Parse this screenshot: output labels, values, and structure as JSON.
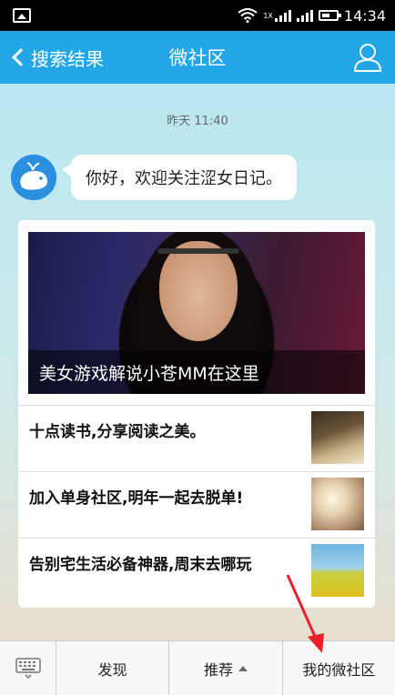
{
  "status_bar": {
    "network_label": "1X",
    "time": "14:34"
  },
  "header": {
    "back_label": "搜索结果",
    "title": "微社区"
  },
  "chat": {
    "timestamp": "昨天 11:40",
    "greeting": "你好，欢迎关注涩女日记。"
  },
  "news": {
    "hero_caption": "美女游戏解说小苍MM在这里",
    "items": [
      {
        "title": "十点读书,分享阅读之美。",
        "thumb": "book-thumbnail"
      },
      {
        "title": "加入单身社区,明年一起去脱单!",
        "thumb": "couple-thumbnail"
      },
      {
        "title": "告别宅生活必备神器,周末去哪玩",
        "thumb": "field-thumbnail"
      }
    ]
  },
  "bottom_menu": {
    "tabs": [
      "发现",
      "推荐",
      "我的微社区"
    ]
  },
  "colors": {
    "header_bg": "#22a6e6",
    "annotation_arrow": "#e8202a"
  }
}
